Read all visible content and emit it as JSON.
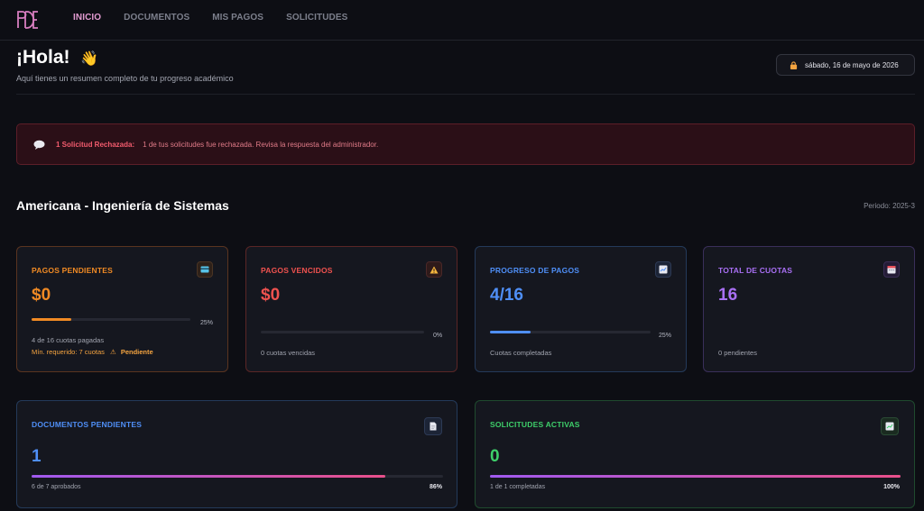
{
  "nav": {
    "items": [
      {
        "label": "INICIO"
      },
      {
        "label": "DOCUMENTOS"
      },
      {
        "label": "MIS PAGOS"
      },
      {
        "label": "SOLICITUDES"
      }
    ]
  },
  "header": {
    "greeting": "¡Hola!",
    "subtitle": "Aquí tienes un resumen completo de tu progreso académico",
    "date": "sábado, 16 de mayo de 2026"
  },
  "alert": {
    "title": "1 Solicitud Rechazada:",
    "message": "1 de tus solicitudes fue rechazada. Revisa la respuesta del administrador."
  },
  "program": {
    "name": "Americana - Ingeniería de Sistemas",
    "period": "Periodo: 2025-3"
  },
  "cards": {
    "pagos_pendientes": {
      "title": "PAGOS PENDIENTES",
      "value": "$0",
      "progress": 25,
      "pct_label": "25%",
      "note": "4 de 16 cuotas pagadas",
      "req": "Mín. requerido: 7 cuotas",
      "req_status": "Pendiente",
      "color": "#f08a24"
    },
    "pagos_vencidos": {
      "title": "PAGOS VENCIDOS",
      "value": "$0",
      "progress": 0,
      "pct_label": "0%",
      "note": "0 cuotas vencidas",
      "color": "#f0524f"
    },
    "progreso_pagos": {
      "title": "PROGRESO DE PAGOS",
      "value": "4/16",
      "progress": 25,
      "pct_label": "25%",
      "note": "Cuotas completadas",
      "color": "#4f8ff7"
    },
    "total_cuotas": {
      "title": "TOTAL DE CUOTAS",
      "value": "16",
      "note": "0 pendientes",
      "color": "#a970f5"
    },
    "documentos": {
      "title": "DOCUMENTOS PENDIENTES",
      "value": "1",
      "progress": 86,
      "pct_label": "86%",
      "note": "6 de 7 aprobados",
      "color": "#4f8ff7"
    },
    "solicitudes": {
      "title": "SOLICITUDES ACTIVAS",
      "value": "0",
      "progress": 100,
      "pct_label": "100%",
      "note": "1 de 1 completadas",
      "color": "#3ecf6a"
    }
  }
}
